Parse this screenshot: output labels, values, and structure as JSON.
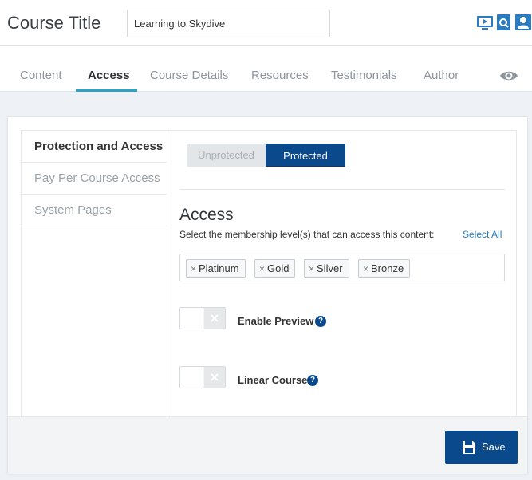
{
  "header": {
    "course_title_label": "Course Title",
    "course_title_value": "Learning to Skydive",
    "icons": [
      "video-icon",
      "search-page-icon",
      "user-card-icon"
    ]
  },
  "tabs": [
    {
      "label": "Content",
      "active": false
    },
    {
      "label": "Access",
      "active": true
    },
    {
      "label": "Course Details",
      "active": false
    },
    {
      "label": "Resources",
      "active": false
    },
    {
      "label": "Testimonials",
      "active": false
    },
    {
      "label": "Author",
      "active": false
    }
  ],
  "sidebar": {
    "items": [
      {
        "label": "Protection and Access",
        "active": true
      },
      {
        "label": "Pay Per Course Access",
        "active": false
      },
      {
        "label": "System Pages",
        "active": false
      }
    ]
  },
  "protection": {
    "unprotected_label": "Unprotected",
    "protected_label": "Protected",
    "selected": "Protected"
  },
  "access": {
    "heading": "Access",
    "description": "Select the membership level(s) that can access this content:",
    "select_all": "Select All",
    "tags": [
      "Platinum",
      "Gold",
      "Silver",
      "Bronze"
    ]
  },
  "toggles": [
    {
      "label": "Enable Preview",
      "enabled": false
    },
    {
      "label": "Linear Course",
      "enabled": false
    }
  ],
  "footer": {
    "save_label": "Save"
  },
  "colors": {
    "primary": "#0a4a8c",
    "tab_accent": "#2aa3c4",
    "link": "#2a7bc0"
  }
}
